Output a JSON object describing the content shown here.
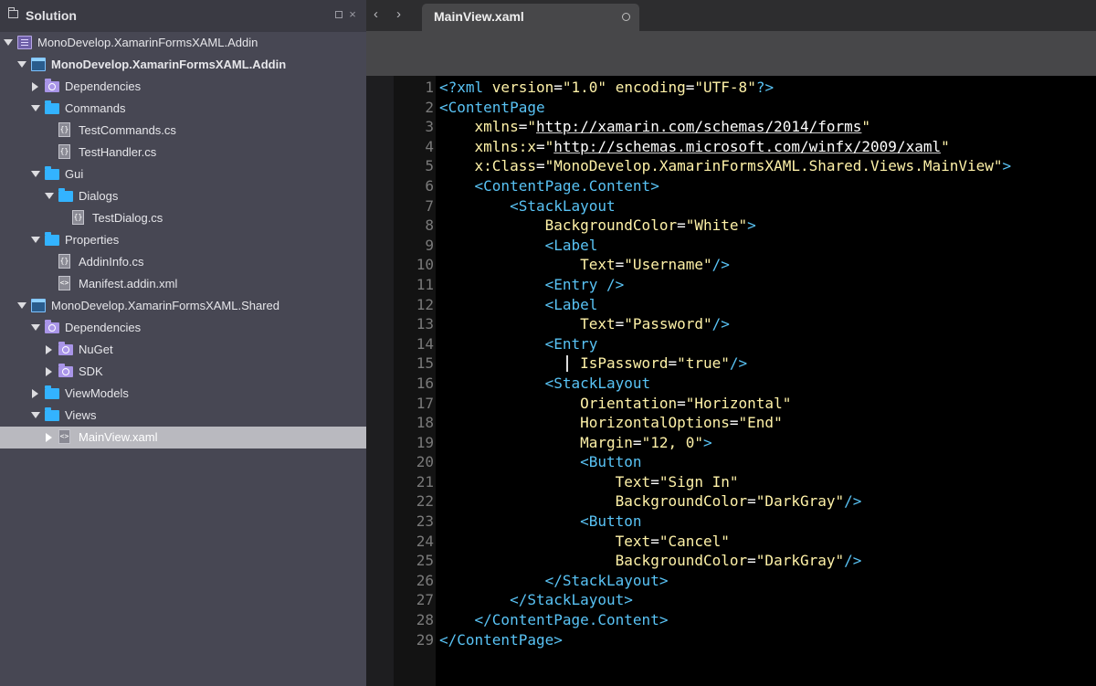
{
  "sidebar": {
    "title": "Solution",
    "dock_glyph": "dock-icon",
    "close_glyph": "×",
    "tree": [
      {
        "label": "MonoDevelop.XamarinFormsXAML.Addin",
        "icon": "solution-icon",
        "level": 0,
        "expanded": true,
        "bold": false,
        "selected": false
      },
      {
        "label": "MonoDevelop.XamarinFormsXAML.Addin",
        "icon": "project-icon",
        "level": 1,
        "expanded": true,
        "bold": true,
        "selected": false
      },
      {
        "label": "Dependencies",
        "icon": "references-icon",
        "level": 2,
        "expanded": false,
        "bold": false,
        "selected": false
      },
      {
        "label": "Commands",
        "icon": "folder-icon",
        "level": 2,
        "expanded": true,
        "bold": false,
        "selected": false
      },
      {
        "label": "TestCommands.cs",
        "icon": "csharp-file-icon",
        "level": 3,
        "expanded": null,
        "bold": false,
        "selected": false
      },
      {
        "label": "TestHandler.cs",
        "icon": "csharp-file-icon",
        "level": 3,
        "expanded": null,
        "bold": false,
        "selected": false
      },
      {
        "label": "Gui",
        "icon": "folder-icon",
        "level": 2,
        "expanded": true,
        "bold": false,
        "selected": false
      },
      {
        "label": "Dialogs",
        "icon": "folder-icon",
        "level": 3,
        "expanded": true,
        "bold": false,
        "selected": false
      },
      {
        "label": "TestDialog.cs",
        "icon": "csharp-file-icon",
        "level": 4,
        "expanded": null,
        "bold": false,
        "selected": false
      },
      {
        "label": "Properties",
        "icon": "folder-icon",
        "level": 2,
        "expanded": true,
        "bold": false,
        "selected": false
      },
      {
        "label": "AddinInfo.cs",
        "icon": "csharp-file-icon",
        "level": 3,
        "expanded": null,
        "bold": false,
        "selected": false
      },
      {
        "label": "Manifest.addin.xml",
        "icon": "xml-file-icon",
        "level": 3,
        "expanded": null,
        "bold": false,
        "selected": false
      },
      {
        "label": "MonoDevelop.XamarinFormsXAML.Shared",
        "icon": "project-icon",
        "level": 1,
        "expanded": true,
        "bold": false,
        "selected": false
      },
      {
        "label": "Dependencies",
        "icon": "references-icon",
        "level": 2,
        "expanded": true,
        "bold": false,
        "selected": false
      },
      {
        "label": "NuGet",
        "icon": "references-icon",
        "level": 3,
        "expanded": false,
        "bold": false,
        "selected": false
      },
      {
        "label": "SDK",
        "icon": "references-icon",
        "level": 3,
        "expanded": false,
        "bold": false,
        "selected": false
      },
      {
        "label": "ViewModels",
        "icon": "folder-icon",
        "level": 2,
        "expanded": false,
        "bold": false,
        "selected": false
      },
      {
        "label": "Views",
        "icon": "folder-icon",
        "level": 2,
        "expanded": true,
        "bold": false,
        "selected": false
      },
      {
        "label": "MainView.xaml",
        "icon": "xml-file-icon",
        "level": 3,
        "expanded": false,
        "bold": false,
        "selected": true
      }
    ]
  },
  "tabbar": {
    "back_glyph": "‹",
    "forward_glyph": "›",
    "active_tab": "MainView.xaml"
  },
  "editor": {
    "caret_line": 15,
    "lines": [
      [
        [
          "pi",
          "<?xml "
        ],
        [
          "attr",
          "version"
        ],
        [
          "pun",
          "="
        ],
        [
          "str",
          "\"1.0\""
        ],
        [
          "pun",
          " "
        ],
        [
          "attr",
          "encoding"
        ],
        [
          "pun",
          "="
        ],
        [
          "str",
          "\"UTF-8\""
        ],
        [
          "pi",
          "?>"
        ]
      ],
      [
        [
          "tag",
          "<ContentPage"
        ]
      ],
      [
        [
          "pun",
          "    "
        ],
        [
          "attr",
          "xmlns"
        ],
        [
          "pun",
          "="
        ],
        [
          "str",
          "\""
        ],
        [
          "ns",
          "http://xamarin.com/schemas/2014/forms"
        ],
        [
          "str",
          "\""
        ]
      ],
      [
        [
          "pun",
          "    "
        ],
        [
          "attr",
          "xmlns:x"
        ],
        [
          "pun",
          "="
        ],
        [
          "str",
          "\""
        ],
        [
          "ns",
          "http://schemas.microsoft.com/winfx/2009/xaml"
        ],
        [
          "str",
          "\""
        ]
      ],
      [
        [
          "pun",
          "    "
        ],
        [
          "attr",
          "x:Class"
        ],
        [
          "pun",
          "="
        ],
        [
          "str",
          "\"MonoDevelop.XamarinFormsXAML.Shared.Views.MainView\""
        ],
        [
          "tag",
          ">"
        ]
      ],
      [
        [
          "pun",
          "    "
        ],
        [
          "tag",
          "<ContentPage.Content>"
        ]
      ],
      [
        [
          "pun",
          "        "
        ],
        [
          "tag",
          "<StackLayout"
        ]
      ],
      [
        [
          "pun",
          "            "
        ],
        [
          "attr",
          "BackgroundColor"
        ],
        [
          "pun",
          "="
        ],
        [
          "str",
          "\"White\""
        ],
        [
          "tag",
          ">"
        ]
      ],
      [
        [
          "pun",
          "            "
        ],
        [
          "tag",
          "<Label"
        ]
      ],
      [
        [
          "pun",
          "                "
        ],
        [
          "attr",
          "Text"
        ],
        [
          "pun",
          "="
        ],
        [
          "str",
          "\"Username\""
        ],
        [
          "tag",
          "/>"
        ]
      ],
      [
        [
          "pun",
          "            "
        ],
        [
          "tag",
          "<Entry />"
        ]
      ],
      [
        [
          "pun",
          "            "
        ],
        [
          "tag",
          "<Label"
        ]
      ],
      [
        [
          "pun",
          "                "
        ],
        [
          "attr",
          "Text"
        ],
        [
          "pun",
          "="
        ],
        [
          "str",
          "\"Password\""
        ],
        [
          "tag",
          "/>"
        ]
      ],
      [
        [
          "pun",
          "            "
        ],
        [
          "tag",
          "<Entry"
        ]
      ],
      [
        [
          "pun",
          "                "
        ],
        [
          "attr",
          "IsPassword"
        ],
        [
          "pun",
          "="
        ],
        [
          "str",
          "\"true\""
        ],
        [
          "tag",
          "/>"
        ]
      ],
      [
        [
          "pun",
          "            "
        ],
        [
          "tag",
          "<StackLayout"
        ]
      ],
      [
        [
          "pun",
          "                "
        ],
        [
          "attr",
          "Orientation"
        ],
        [
          "pun",
          "="
        ],
        [
          "str",
          "\"Horizontal\""
        ]
      ],
      [
        [
          "pun",
          "                "
        ],
        [
          "attr",
          "HorizontalOptions"
        ],
        [
          "pun",
          "="
        ],
        [
          "str",
          "\"End\""
        ]
      ],
      [
        [
          "pun",
          "                "
        ],
        [
          "attr",
          "Margin"
        ],
        [
          "pun",
          "="
        ],
        [
          "str",
          "\"12, 0\""
        ],
        [
          "tag",
          ">"
        ]
      ],
      [
        [
          "pun",
          "                "
        ],
        [
          "tag",
          "<Button"
        ]
      ],
      [
        [
          "pun",
          "                    "
        ],
        [
          "attr",
          "Text"
        ],
        [
          "pun",
          "="
        ],
        [
          "str",
          "\"Sign In\""
        ]
      ],
      [
        [
          "pun",
          "                    "
        ],
        [
          "attr",
          "BackgroundColor"
        ],
        [
          "pun",
          "="
        ],
        [
          "str",
          "\"DarkGray\""
        ],
        [
          "tag",
          "/>"
        ]
      ],
      [
        [
          "pun",
          "                "
        ],
        [
          "tag",
          "<Button"
        ]
      ],
      [
        [
          "pun",
          "                    "
        ],
        [
          "attr",
          "Text"
        ],
        [
          "pun",
          "="
        ],
        [
          "str",
          "\"Cancel\""
        ]
      ],
      [
        [
          "pun",
          "                    "
        ],
        [
          "attr",
          "BackgroundColor"
        ],
        [
          "pun",
          "="
        ],
        [
          "str",
          "\"DarkGray\""
        ],
        [
          "tag",
          "/>"
        ]
      ],
      [
        [
          "pun",
          "            "
        ],
        [
          "tag",
          "</StackLayout>"
        ]
      ],
      [
        [
          "pun",
          "        "
        ],
        [
          "tag",
          "</StackLayout>"
        ]
      ],
      [
        [
          "pun",
          "    "
        ],
        [
          "tag",
          "</ContentPage.Content>"
        ]
      ],
      [
        [
          "tag",
          "</ContentPage>"
        ]
      ]
    ]
  },
  "colors": {
    "sidebar_bg": "#474753",
    "selection_bg": "#b9b9bf",
    "editor_bg": "#000000",
    "tag": "#59c3f5",
    "attribute": "#fff2a8",
    "string": "#fff2a8"
  }
}
